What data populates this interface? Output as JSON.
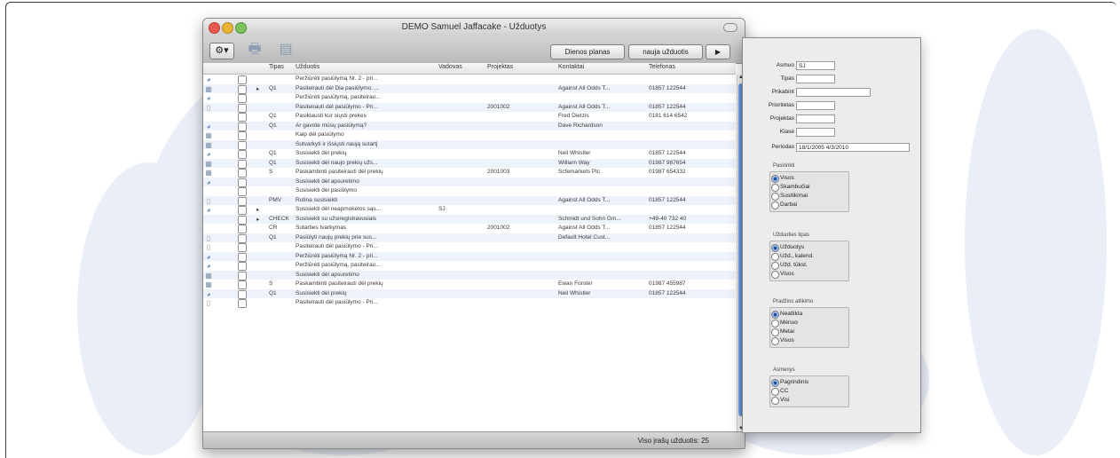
{
  "window": {
    "title": "DEMO  Samuel Jaffacake - Užduotys",
    "toolbar": {
      "gear_icon": "gear-icon",
      "print_icon": "printer-icon",
      "new_icon": "new-task-icon",
      "btn_plan": "Dienos planas",
      "btn_new": "nauja užduotis",
      "btn_play": "▶"
    },
    "columns": [
      "Tipas",
      "Užduotis",
      "Vadovas",
      "Projektas",
      "Kontaktai",
      "Telefonas"
    ],
    "rows": [
      {
        "icon": "person",
        "flag": "",
        "type": "",
        "task": "Peržiūrėti pasiūlymą Nr. 2 - pri...",
        "lead": "",
        "project": "",
        "contact": "",
        "phone": ""
      },
      {
        "icon": "doc",
        "flag": "▸",
        "type": "Q1",
        "task": "Pasiteirauti dėl Dia pasiūlymo. ...",
        "lead": "",
        "project": "",
        "contact": "Against All Odds T...",
        "phone": "01857 122544"
      },
      {
        "icon": "person",
        "flag": "",
        "type": "",
        "task": "Peržiūrėti pasiūlymą, pasiteirau...",
        "lead": "",
        "project": "",
        "contact": "",
        "phone": ""
      },
      {
        "icon": "lock",
        "flag": "",
        "type": "",
        "task": "Pasiteirauti dėl pasiūlymo - Pri...",
        "lead": "",
        "project": "2001002",
        "contact": "Against All Odds T...",
        "phone": "01857 122544"
      },
      {
        "icon": "",
        "flag": "",
        "type": "Q1",
        "task": "Pasiklausti kur siųsti prekes",
        "lead": "",
        "project": "",
        "contact": "Fred Dietzis",
        "phone": "0181 614 6542"
      },
      {
        "icon": "person",
        "flag": "",
        "type": "Q1",
        "task": "Ar gavote mūsų pasiūlymą?",
        "lead": "",
        "project": "",
        "contact": "Dave Richardson",
        "phone": ""
      },
      {
        "icon": "doc",
        "flag": "",
        "type": "",
        "task": "Kaip dėl pasiūlymo",
        "lead": "",
        "project": "",
        "contact": "",
        "phone": ""
      },
      {
        "icon": "doc",
        "flag": "",
        "type": "",
        "task": "Sutvarkyti ir išsiųsti naują sutartį",
        "lead": "",
        "project": "",
        "contact": "",
        "phone": ""
      },
      {
        "icon": "person",
        "flag": "",
        "type": "Q1",
        "task": "Susisiekti dėl prekių",
        "lead": "",
        "project": "",
        "contact": "Neil Whistler",
        "phone": "01857 122544"
      },
      {
        "icon": "doc",
        "flag": "",
        "type": "Q1",
        "task": "Susisiekti dėl naujo prekių užs...",
        "lead": "",
        "project": "",
        "contact": "William Way",
        "phone": "01987 987654"
      },
      {
        "icon": "doc",
        "flag": "",
        "type": "S",
        "task": "Paskambinti pasiteirauti dėl prekių",
        "lead": "",
        "project": "2001003",
        "contact": "Scfemarkets Plc",
        "phone": "01987 654332"
      },
      {
        "icon": "person",
        "flag": "",
        "type": "",
        "task": "Susisiekti dėl apsuretimo",
        "lead": "",
        "project": "",
        "contact": "",
        "phone": ""
      },
      {
        "icon": "",
        "flag": "",
        "type": "",
        "task": "Susisiekti dėl pasiūlymo",
        "lead": "",
        "project": "",
        "contact": "",
        "phone": ""
      },
      {
        "icon": "lock",
        "flag": "",
        "type": "PMV",
        "task": "Rutina susisiekti",
        "lead": "",
        "project": "",
        "contact": "Against All Odds T...",
        "phone": "01857 122544"
      },
      {
        "icon": "person",
        "flag": "▸",
        "type": "",
        "task": "Susisiekti dėl neapmokėtos sąs...",
        "lead": "SJ",
        "project": "",
        "contact": "",
        "phone": ""
      },
      {
        "icon": "",
        "flag": "▸",
        "type": "CHECK",
        "task": "Susisiekti su užsiregistravusiais",
        "lead": "",
        "project": "",
        "contact": "Schmidt und Sohn Gm...",
        "phone": "+49-40 732 40"
      },
      {
        "icon": "",
        "flag": "",
        "type": "CR",
        "task": "Sutarties tvarkymas",
        "lead": "",
        "project": "2001002",
        "contact": "Against All Odds T...",
        "phone": "01857 122544"
      },
      {
        "icon": "lock",
        "flag": "",
        "type": "Q1",
        "task": "Pasiūlyti naujų prekių prie sus...",
        "lead": "",
        "project": "",
        "contact": "Default Hotel Cust...",
        "phone": ""
      },
      {
        "icon": "lock",
        "flag": "",
        "type": "",
        "task": "Pasiteirauti dėl pasiūlymo - Pri...",
        "lead": "",
        "project": "",
        "contact": "",
        "phone": ""
      },
      {
        "icon": "person",
        "flag": "",
        "type": "",
        "task": "Peržiūrėti pasiūlymą Nr. 2 - pri...",
        "lead": "",
        "project": "",
        "contact": "",
        "phone": ""
      },
      {
        "icon": "person",
        "flag": "",
        "type": "",
        "task": "Peržiūrėti pasiūlymą, pasiteirau...",
        "lead": "",
        "project": "",
        "contact": "",
        "phone": ""
      },
      {
        "icon": "doc",
        "flag": "",
        "type": "",
        "task": "Susisiekti dėl apsuretimo",
        "lead": "",
        "project": "",
        "contact": "",
        "phone": ""
      },
      {
        "icon": "doc",
        "flag": "",
        "type": "S",
        "task": "Paskambinti pasiteirauti dėl prekių",
        "lead": "",
        "project": "",
        "contact": "Ewan Forster",
        "phone": "01987 455987"
      },
      {
        "icon": "person",
        "flag": "",
        "type": "Q1",
        "task": "Susisiekti dėl prekių",
        "lead": "",
        "project": "",
        "contact": "Neil Whistler",
        "phone": "01857 122544"
      },
      {
        "icon": "lock",
        "flag": "",
        "type": "",
        "task": "Pasiteirauti dėl pasiūlymo - Pri...",
        "lead": "",
        "project": "",
        "contact": "",
        "phone": ""
      }
    ],
    "status": "Viso įrašų užduotis: 25"
  },
  "filter": {
    "fields": [
      {
        "label": "Asmuo",
        "value": "SJ"
      },
      {
        "label": "Tipas",
        "value": ""
      },
      {
        "label": "Prikabint",
        "value": ""
      },
      {
        "label": "Prioritetas",
        "value": ""
      },
      {
        "label": "Projektas",
        "value": ""
      },
      {
        "label": "Klasė",
        "value": ""
      },
      {
        "label": "Periodas",
        "value": "18/1/2005 4/3/2010"
      }
    ],
    "groups": [
      {
        "title": "Pasirinkti",
        "options": [
          "Visos",
          "Skambučiai",
          "Susitikimai",
          "Darbai"
        ],
        "selected": 0
      },
      {
        "title": "Užduoties tipas",
        "options": [
          "Užduotys",
          "Užd., kalend.",
          "Užd. tūkst.",
          "Visos"
        ],
        "selected": 0
      },
      {
        "title": "Pradžios atlikimo",
        "options": [
          "Neatlikta",
          "Mėnuo",
          "Metai",
          "Visos"
        ],
        "selected": 0
      },
      {
        "title": "Asmenys",
        "options": [
          "Pagrindinis",
          "CC",
          "Visi"
        ],
        "selected": 0
      }
    ]
  }
}
